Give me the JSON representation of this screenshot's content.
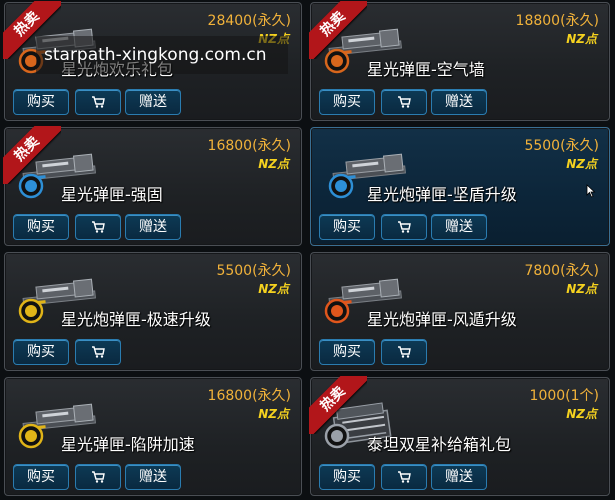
{
  "watermark": "starpath-xingkong.com.cn",
  "hot_badge_label": "热卖",
  "currency_label": "NZ点",
  "buttons": {
    "buy": "购买",
    "gift": "赠送"
  },
  "items": [
    {
      "price": "28400(永久)",
      "name": "星光炮欢乐礼包",
      "hot": true,
      "gift": true,
      "icon": "cannon-gift-pack-icon",
      "accent": "#d8661c"
    },
    {
      "price": "18800(永久)",
      "name": "星光弹匣-空气墙",
      "hot": true,
      "gift": true,
      "icon": "magazine-air-wall-icon",
      "accent": "#d8661c"
    },
    {
      "price": "16800(永久)",
      "name": "星光弹匣-强固",
      "hot": true,
      "gift": true,
      "icon": "magazine-reinforce-icon",
      "accent": "#2d8fd6"
    },
    {
      "price": "5500(永久)",
      "name": "星光炮弹匣-坚盾升级",
      "hot": false,
      "gift": true,
      "icon": "shield-upgrade-icon",
      "accent": "#2d8fd6",
      "selected": true
    },
    {
      "price": "5500(永久)",
      "name": "星光炮弹匣-极速升级",
      "hot": false,
      "gift": false,
      "icon": "speed-upgrade-icon",
      "accent": "#e0b418"
    },
    {
      "price": "7800(永久)",
      "name": "星光炮弹匣-风遁升级",
      "hot": false,
      "gift": false,
      "icon": "wind-upgrade-icon",
      "accent": "#e0561c"
    },
    {
      "price": "16800(永久)",
      "name": "星光弹匣-陷阱加速",
      "hot": false,
      "gift": true,
      "icon": "trap-accelerate-icon",
      "accent": "#e0b418"
    },
    {
      "price": "1000(1个)",
      "name": "泰坦双星补给箱礼包",
      "hot": true,
      "gift": true,
      "icon": "supply-crate-gift-icon",
      "accent": "#9aa0a8"
    }
  ]
}
